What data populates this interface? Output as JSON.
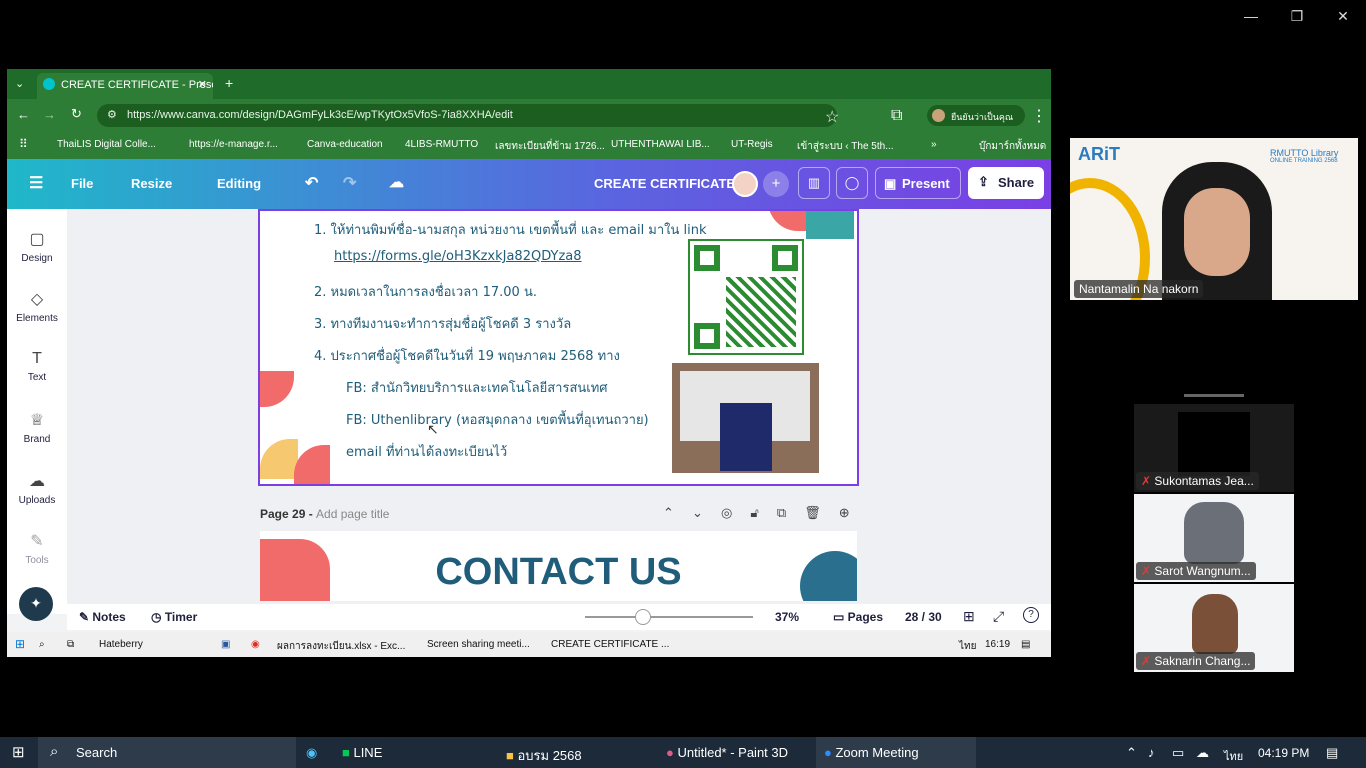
{
  "zoom_window": {
    "minimize": "—",
    "restore": "❐",
    "close": "✕"
  },
  "browser": {
    "tab_title": "CREATE CERTIFICATE - Presenta",
    "url": "https://www.canva.com/design/DAGmFyLk3cE/wpTKytOx5VfoS-7ia8XXHA/edit",
    "profile_label": "ยืนยันว่าเป็นคุณ",
    "bookmarks": [
      "ThaiLIS Digital Colle...",
      "https://e-manage.r...",
      "Canva-education",
      "4LIBS-RMUTTO",
      "เลขทะเบียนที่ข้าม 1726...",
      "UTHENTHAWAI LIB...",
      "UT-Regis",
      "เข้าสู่ระบบ ‹ The 5th..."
    ],
    "bookmarks_folder": "บุ๊กมาร์กทั้งหมด"
  },
  "canva": {
    "menu": {
      "file": "File",
      "resize": "Resize",
      "editing": "Editing"
    },
    "doc_title": "CREATE CERTIFICATE",
    "present": "Present",
    "share": "Share",
    "rail": [
      "Design",
      "Elements",
      "Text",
      "Brand",
      "Uploads",
      "Tools"
    ],
    "slide_lines": [
      "1. ให้ท่านพิมพ์ชื่อ-นามสกุล หน่วยงาน เขตพื้นที่ และ email มาใน link",
      "https://forms.gle/oH3KzxkJa82QDYza8",
      "2. หมดเวลาในการลงชื่อเวลา 17.00 น.",
      "3. ทางทีมงานจะทำการสุ่มชื่อผู้โชคดี 3 รางวัล",
      "4. ประกาศชื่อผู้โชคดีในวันที่ 19 พฤษภาคม 2568 ทาง",
      "FB: สำนักวิทยบริการและเทคโนโลยีสารสนเทศ",
      "FB: Uthenlibrary (หอสมุดกลาง เขตพื้นที่อุเทนถวาย)",
      "email ที่ท่านได้ลงทะเบียนไว้"
    ],
    "page_label": "Page 29 - ",
    "page_placeholder": "Add page title",
    "next_slide_title": "CONTACT US",
    "footer": {
      "notes": "Notes",
      "timer": "Timer",
      "zoom": "37%",
      "pages": "Pages",
      "page_count": "28 / 30"
    }
  },
  "inner_taskbar": {
    "items": [
      "Hateberry",
      "ผลการลงทะเบียน.xlsx - Exc...",
      "Screen sharing meeti...",
      "CREATE CERTIFICATE ..."
    ],
    "lang": "ไทย",
    "time": "16:19"
  },
  "participants": {
    "speaker": "Nantamalin Na nakorn",
    "speaker_logo": "RMUTTO Library",
    "speaker_sub": "ONLINE TRAINING 2568",
    "tiles": [
      "Sukontamas Jea...",
      "Sarot Wangnum...",
      "Saknarin Chang..."
    ]
  },
  "taskbar": {
    "search": "Search",
    "apps": [
      "LINE",
      "อบรม 2568",
      "Untitled* - Paint 3D",
      "Zoom Meeting"
    ],
    "lang": "ไทย",
    "time": "04:19 PM"
  },
  "colors": {
    "canva_gradient_start": "#1fb8c9",
    "canva_gradient_end": "#7b3fe4",
    "slide_text": "#1f5d7a",
    "browser_green": "#2e7d36"
  }
}
